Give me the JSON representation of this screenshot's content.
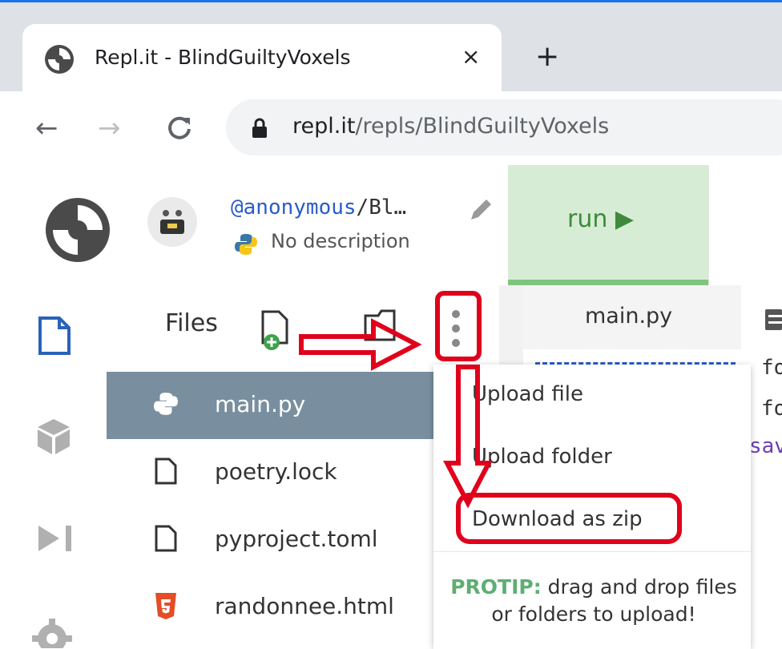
{
  "browser": {
    "tab_title": "Repl.it - BlindGuiltyVoxels",
    "tab_close": "×",
    "new_tab": "+",
    "url_host": "repl.it",
    "url_path": "/repls/BlindGuiltyVoxels"
  },
  "header": {
    "user_handle": "@anonymous",
    "repl_name_truncated": "/Bl…",
    "description": "No description",
    "run_label": "run ▶"
  },
  "files_panel": {
    "title": "Files",
    "files": [
      {
        "name": "main.py",
        "icon": "python-icon",
        "active": true
      },
      {
        "name": "poetry.lock",
        "icon": "file-icon",
        "active": false
      },
      {
        "name": "pyproject.toml",
        "icon": "file-icon",
        "active": false
      },
      {
        "name": "randonnee.html",
        "icon": "html5-icon",
        "active": false
      }
    ]
  },
  "menu": {
    "items": [
      "Upload file",
      "Upload folder",
      "Download as zip"
    ],
    "protip_label": "PROTIP:",
    "protip_text": " drag and drop files or folders to upload!"
  },
  "editor": {
    "tab_label": "main.py",
    "line1": "fo",
    "line2": "fo",
    "line3": "sav"
  },
  "colors": {
    "accent_red": "#e0001c",
    "run_green": "#3e8a3a",
    "active_file": "#798f9f"
  }
}
